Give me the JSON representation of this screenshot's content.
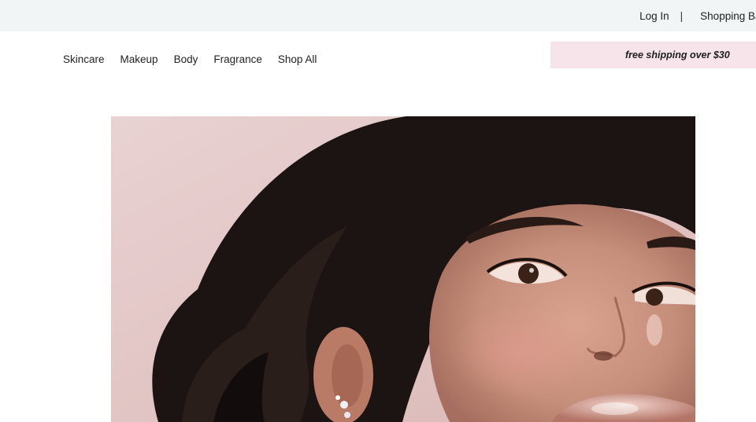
{
  "utility": {
    "login_label": "Log In",
    "separator": "|",
    "bag_label": "Shopping Bag"
  },
  "nav": {
    "items": [
      {
        "label": "Skincare"
      },
      {
        "label": "Makeup"
      },
      {
        "label": "Body"
      },
      {
        "label": "Fragrance"
      },
      {
        "label": "Shop All"
      }
    ]
  },
  "promo": {
    "text": "free shipping over $30",
    "background": "#f6e4ea"
  },
  "hero": {
    "image_subject": "model-portrait-photo"
  },
  "colors": {
    "utility_bar": "#f1f5f6",
    "hero_backdrop": "#e6cfd0"
  }
}
